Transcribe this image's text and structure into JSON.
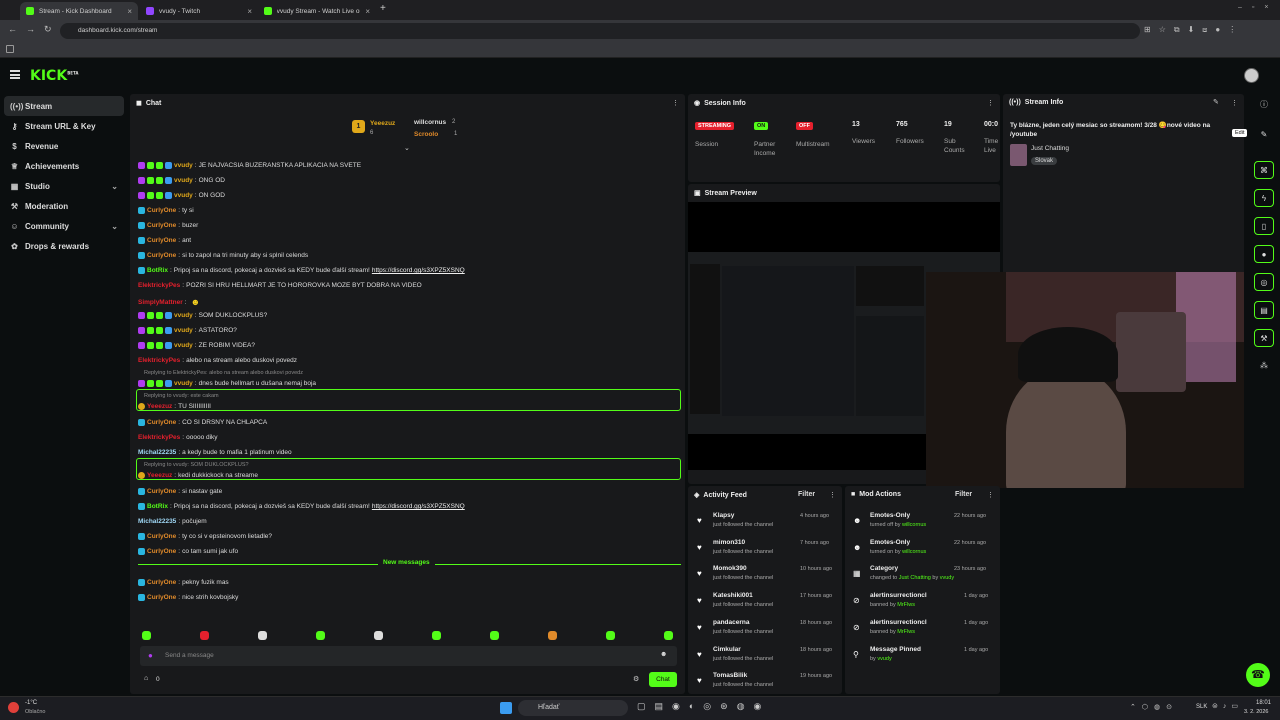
{
  "browser": {
    "tabs": [
      {
        "label": "Stream - Kick Dashboard",
        "color": "#53fc18"
      },
      {
        "label": "vvudy - Twitch",
        "color": "#9146ff"
      },
      {
        "label": "vvudy Stream - Watch Live on Kick",
        "color": "#53fc18"
      }
    ],
    "url": "dashboard.kick.com/stream"
  },
  "kick": {
    "logo": "KICK",
    "beta": "BETA"
  },
  "sidebar": {
    "items": [
      {
        "label": "Stream",
        "icon": "stream-icon"
      },
      {
        "label": "Stream URL & Key",
        "icon": "key-icon"
      },
      {
        "label": "Revenue",
        "icon": "dollar-icon"
      },
      {
        "label": "Achievements",
        "icon": "trophy-icon"
      },
      {
        "label": "Studio",
        "icon": "studio-icon"
      },
      {
        "label": "Moderation",
        "icon": "wrench-icon"
      },
      {
        "label": "Community",
        "icon": "people-icon"
      },
      {
        "label": "Drops & rewards",
        "icon": "gift-icon"
      }
    ]
  },
  "chat": {
    "title": "Chat",
    "leaderboard": {
      "first": {
        "name": "Yeeezuz",
        "n": "6"
      },
      "second": {
        "name": "willcornus",
        "n": "2"
      },
      "third": {
        "name": "Scroolo",
        "n": "1"
      },
      "rank": "1"
    },
    "messages": [
      {
        "user": "vvudy",
        "text": "JE NAJVACSIA BUZERANSTKA APLIKACIA NA SVETE"
      },
      {
        "user": "vvudy",
        "text": "ONG OD"
      },
      {
        "user": "vvudy",
        "text": "ON GOD"
      },
      {
        "user": "CurlyOne",
        "text": "ty si"
      },
      {
        "user": "CurlyOne",
        "text": "buzer"
      },
      {
        "user": "CurlyOne",
        "text": "ant"
      },
      {
        "user": "CurlyOne",
        "text": "si to zapol na tri minuty aby si splnil celends"
      },
      {
        "user": "BotRix",
        "text": "Pripoj sa na discord, pokecaj a dozvieš sa KEDY bude ďalší stream!",
        "link": "https://discord.gg/s3XPZ5XSNQ"
      },
      {
        "user": "ElektrickyPes",
        "text": "POZRI SI HRU HELLMART JE TO HOROROVKA MOZE BYT DOBRA NA VIDEO"
      },
      {
        "user": "SimplyMattner",
        "text": ""
      },
      {
        "user": "vvudy",
        "text": "SOM DUKLOCKPLUS?"
      },
      {
        "user": "vvudy",
        "text": "ASTATORO?"
      },
      {
        "user": "vvudy",
        "text": "ZE ROBIM VIDEA?"
      },
      {
        "user": "ElektrickyPes",
        "text": "alebo na stream alebo duskovi povedz"
      },
      {
        "user": "vvudy",
        "text": "dnes bude hellmart u dušana nemaj boja",
        "reply": "Replying to ElektrickyPes: alebo na stream alebo duskovi povedz"
      },
      {
        "user": "Yeeezuz",
        "text": "TU SIIIIIIIIII",
        "reply": "Replying to vvudy: este cakam"
      },
      {
        "user": "CurlyOne",
        "text": "CO SI DRSNY NA CHLAPCA"
      },
      {
        "user": "ElektrickyPes",
        "text": "ooooo diky"
      },
      {
        "user": "Michal22235",
        "text": "a kedy bude to mafia 1 platinum video"
      },
      {
        "user": "Yeeezuz",
        "text": "kedi dukkickock na streame",
        "reply": "Replying to vvudy: SOM DUKLOCKPLUS?"
      },
      {
        "user": "CurlyOne",
        "text": "si nastav gate"
      },
      {
        "user": "BotRix",
        "text": "Pripoj sa na discord, pokecaj a dozvieš sa KEDY bude ďalší stream!",
        "link": "https://discord.gg/s3XPZ5XSNQ"
      },
      {
        "user": "Michal22235",
        "text": "počujem"
      },
      {
        "user": "CurlyOne",
        "text": "ty co si v epsteinovom lietadle?"
      },
      {
        "user": "CurlyOne",
        "text": "co tam sumi jak ufo"
      },
      {
        "user": "CurlyOne",
        "text": "pekny fuzik mas"
      },
      {
        "user": "CurlyOne",
        "text": "nice strih kovbojsky"
      }
    ],
    "new_messages": "New messages",
    "placeholder": "Send a message",
    "count": "0",
    "send": "Chat"
  },
  "session": {
    "title": "Session Info",
    "streaming": "STREAMING",
    "on": "ON",
    "off": "OFF",
    "labels": [
      "Session",
      "Partner Income",
      "Multistream"
    ],
    "stats": [
      {
        "value": "13",
        "label": "Viewers"
      },
      {
        "value": "765",
        "label": "Followers"
      },
      {
        "value": "19",
        "label": "Sub Counts"
      },
      {
        "value": "00:0",
        "label": "Time Live"
      }
    ]
  },
  "streaminfo": {
    "title": "Stream Info",
    "text": "Ty blázne, jeden celý mesiac so streamom! 3/28 😋nové video na /youtube",
    "category": "Just Chatting",
    "lang": "Slovak",
    "tooltip": "Edit"
  },
  "preview": {
    "title": "Stream Preview"
  },
  "activity": {
    "title": "Activity Feed",
    "filter": "Filter",
    "items": [
      {
        "user": "Klapsy",
        "sub": "just followed the channel",
        "time": "4 hours ago"
      },
      {
        "user": "mimon310",
        "sub": "just followed the channel",
        "time": "7 hours ago"
      },
      {
        "user": "Momok390",
        "sub": "just followed the channel",
        "time": "10 hours ago"
      },
      {
        "user": "Kateshiki001",
        "sub": "just followed the channel",
        "time": "17 hours ago"
      },
      {
        "user": "pandacerna",
        "sub": "just followed the channel",
        "time": "18 hours ago"
      },
      {
        "user": "Cimkular",
        "sub": "just followed the channel",
        "time": "18 hours ago"
      },
      {
        "user": "TomasBilik",
        "sub": "just followed the channel",
        "time": "19 hours ago"
      }
    ]
  },
  "modactions": {
    "title": "Mod Actions",
    "filter": "Filter",
    "items": [
      {
        "title": "Emotes-Only",
        "sub": "turned off by",
        "who": "willcornus",
        "time": "22 hours ago"
      },
      {
        "title": "Emotes-Only",
        "sub": "turned on by",
        "who": "willcornus",
        "time": "22 hours ago"
      },
      {
        "title": "Category",
        "sub": "changed to",
        "who": "Just Chatting",
        "by": "by",
        "who2": "vvudy",
        "time": "23 hours ago"
      },
      {
        "title": "alertinsurrectioncl",
        "sub": "banned by",
        "who": "MrFlws",
        "time": "1 day ago"
      },
      {
        "title": "alertinsurrectioncl",
        "sub": "banned by",
        "who": "MrFlws",
        "time": "1 day ago"
      },
      {
        "title": "Message Pinned",
        "sub": "by",
        "who": "vvudy",
        "time": "1 day ago"
      }
    ]
  },
  "taskbar": {
    "weather": "-1°C",
    "weather2": "Oblačno",
    "search": "Hľadať",
    "lang": "SLK",
    "time": "18:01",
    "date": "3. 2. 2026"
  },
  "colors": {
    "accent": "#53fc18",
    "streaming": "#e5202d",
    "on": "#53fc18",
    "off": "#e5202d"
  }
}
